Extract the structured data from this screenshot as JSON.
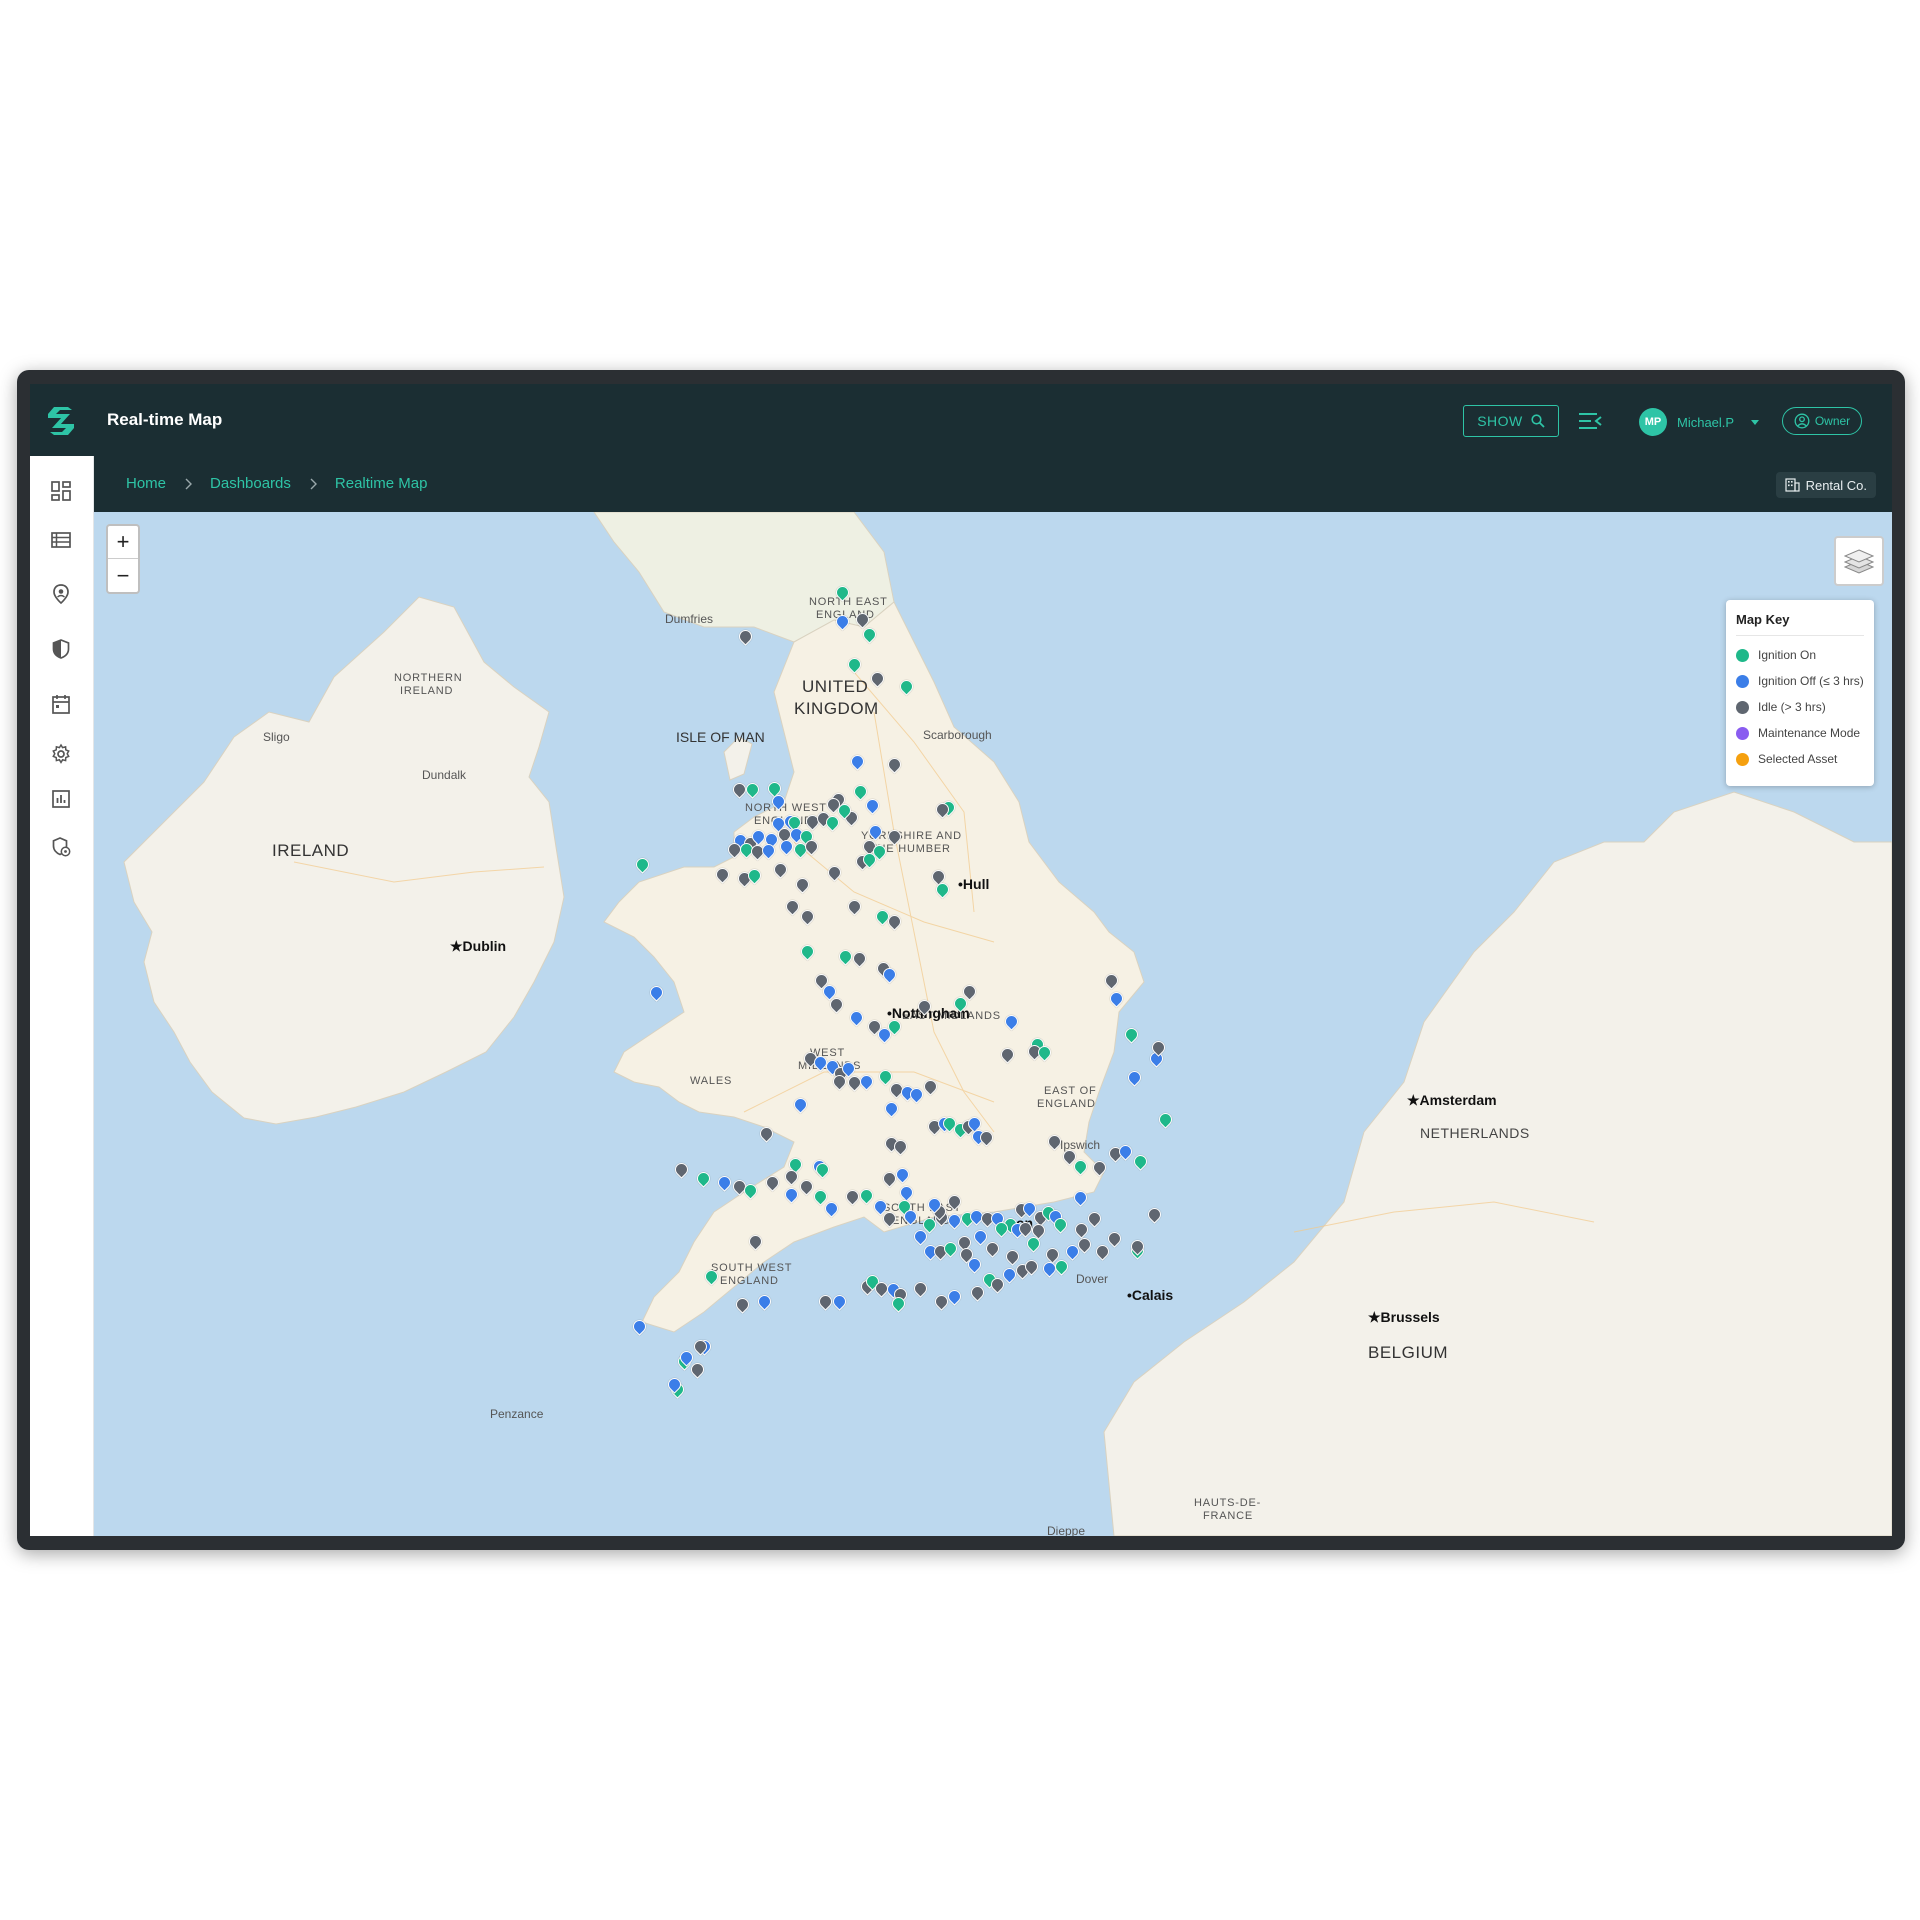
{
  "app": {
    "title": "Real-time Map"
  },
  "header": {
    "show_label": "SHOW",
    "user_initials": "MP",
    "user_name": "Michael.P",
    "role_label": "Owner"
  },
  "breadcrumb": [
    "Home",
    "Dashboards",
    "Realtime Map"
  ],
  "company": "Rental Co.",
  "sidebar": [
    {
      "icon": "dashboard-icon"
    },
    {
      "icon": "list-icon"
    },
    {
      "icon": "location-pin-icon"
    },
    {
      "icon": "shield-icon"
    },
    {
      "icon": "calendar-icon"
    },
    {
      "icon": "gear-icon"
    },
    {
      "icon": "bar-chart-icon"
    },
    {
      "icon": "shield-settings-icon"
    }
  ],
  "map": {
    "zoom_in": "+",
    "zoom_out": "−",
    "key": {
      "title": "Map Key",
      "items": [
        {
          "label": "Ignition On",
          "color": "#1fb88a"
        },
        {
          "label": "Ignition Off (≤ 3 hrs)",
          "color": "#3b7ee8"
        },
        {
          "label": "Idle (> 3 hrs)",
          "color": "#5f6670"
        },
        {
          "label": "Maintenance Mode",
          "color": "#8a5cf0"
        },
        {
          "label": "Selected Asset",
          "color": "#f5a00f"
        }
      ]
    },
    "labels": {
      "ireland": "IRELAND",
      "northern_ireland_1": "NORTHERN",
      "northern_ireland_2": "IRELAND",
      "uk_1": "UNITED",
      "uk_2": "KINGDOM",
      "isle_of_man": "ISLE OF MAN",
      "north_east_1": "NORTH EAST",
      "north_east_2": "ENGLAND",
      "north_west_1": "NORTH WEST",
      "north_west_2": "ENGLAND",
      "yorkshire_1": "YORKSHIRE AND",
      "yorkshire_2": "THE HUMBER",
      "east_midlands": "EAST MIDLANDS",
      "west_midlands_1": "WEST",
      "west_midlands_2": "MIDLANDS",
      "wales": "WALES",
      "east_1": "EAST OF",
      "east_2": "ENGLAND",
      "south_east_1": "SOUTH EAST",
      "south_east_2": "ENGLAND",
      "south_west_1": "SOUTH WEST",
      "south_west_2": "ENGLAND",
      "netherlands": "NETHERLANDS",
      "belgium": "BELGIUM",
      "hauts_1": "HAUTS-DE-",
      "hauts_2": "FRANCE",
      "dumfries": "Dumfries",
      "sligo": "Sligo",
      "dundalk": "Dundalk",
      "scarborough": "Scarborough",
      "ipswich": "Ipswich",
      "dover": "Dover",
      "penzance": "Penzance",
      "dieppe": "Dieppe",
      "dublin": "★Dublin",
      "hull": "•Hull",
      "nottingham": "•Nottingham",
      "amsterdam": "★Amsterdam",
      "calais": "•Calais",
      "brussels": "★Brussels",
      "london": "on"
    }
  }
}
